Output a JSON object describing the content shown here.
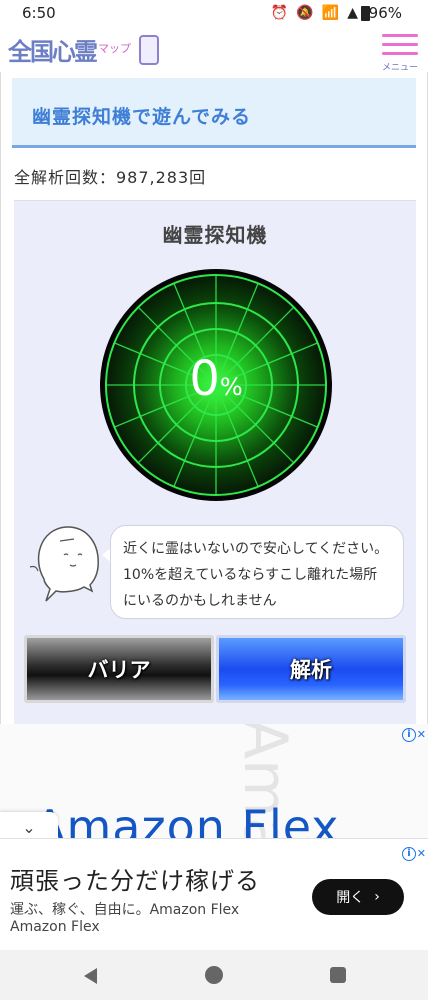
{
  "status_bar": {
    "time": "6:50",
    "battery": "96%"
  },
  "header": {
    "logo_text": "全国心霊",
    "logo_sub": "マップ",
    "menu_label": "メニュー"
  },
  "section": {
    "title": "幽霊探知機で遊んでみる",
    "analysis_count": "全解析回数：987,283回"
  },
  "detector": {
    "title": "幽霊探知機",
    "percent_value": "0",
    "percent_sign": "%",
    "level": 0,
    "message": "近くに霊はいないので安心してください。10%を超えているならすこし離れた場所にいるのかもしれません"
  },
  "buttons": {
    "barrier": "バリア",
    "analyze": "解析"
  },
  "ad": {
    "headline": "Amazon Flex",
    "watermark": "Amaz",
    "anchor_title": "頑張った分だけ稼げる",
    "anchor_desc": "運ぶ、稼ぐ、自由に。Amazon Flex",
    "anchor_brand": "Amazon Flex",
    "open_label": "開く",
    "info_symbol": "i",
    "close_symbol": "✕",
    "collapse_symbol": "⌄"
  },
  "icons": {
    "alarm": "alarm-icon",
    "mute": "mute-icon",
    "wifi": "wifi-icon",
    "signal": "signal-icon"
  },
  "colors": {
    "radar_green": "#2ee84a",
    "section_blue": "#3f7fd6",
    "analyze_blue": "#1c4bf0"
  }
}
